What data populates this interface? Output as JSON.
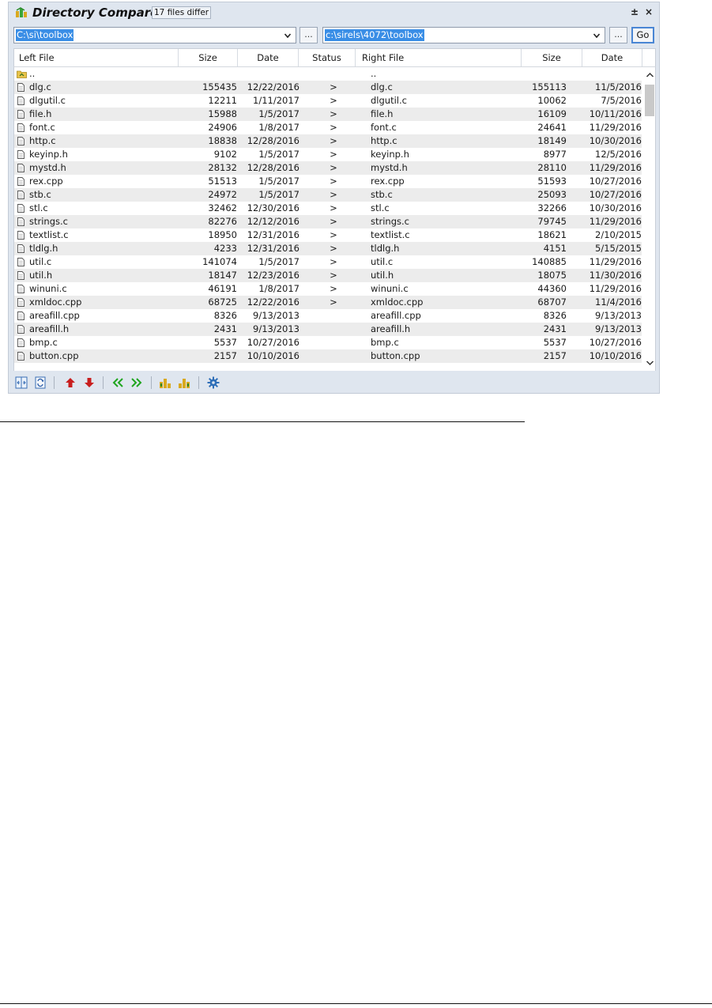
{
  "window": {
    "title": "Directory Compare",
    "diff_badge": "17 files differ",
    "pin_glyph": "±",
    "close_glyph": "×"
  },
  "paths": {
    "left": "C:\\si\\toolbox",
    "right": "c:\\sirels\\4072\\toolbox",
    "browse_label": "...",
    "go_label": "Go"
  },
  "columns": {
    "left_file": "Left File",
    "left_size": "Size",
    "left_date": "Date",
    "status": "Status",
    "right_file": "Right File",
    "right_size": "Size",
    "right_date": "Date"
  },
  "parent_row": {
    "left": "..",
    "right": ".."
  },
  "rows": [
    {
      "lname": "dlg.c",
      "lsize": "155435",
      "ldate": "12/22/2016",
      "status": ">",
      "rname": "dlg.c",
      "rsize": "155113",
      "rdate": "11/5/2016"
    },
    {
      "lname": "dlgutil.c",
      "lsize": "12211",
      "ldate": "1/11/2017",
      "status": ">",
      "rname": "dlgutil.c",
      "rsize": "10062",
      "rdate": "7/5/2016"
    },
    {
      "lname": "file.h",
      "lsize": "15988",
      "ldate": "1/5/2017",
      "status": ">",
      "rname": "file.h",
      "rsize": "16109",
      "rdate": "10/11/2016"
    },
    {
      "lname": "font.c",
      "lsize": "24906",
      "ldate": "1/8/2017",
      "status": ">",
      "rname": "font.c",
      "rsize": "24641",
      "rdate": "11/29/2016"
    },
    {
      "lname": "http.c",
      "lsize": "18838",
      "ldate": "12/28/2016",
      "status": ">",
      "rname": "http.c",
      "rsize": "18149",
      "rdate": "10/30/2016"
    },
    {
      "lname": "keyinp.h",
      "lsize": "9102",
      "ldate": "1/5/2017",
      "status": ">",
      "rname": "keyinp.h",
      "rsize": "8977",
      "rdate": "12/5/2016"
    },
    {
      "lname": "mystd.h",
      "lsize": "28132",
      "ldate": "12/28/2016",
      "status": ">",
      "rname": "mystd.h",
      "rsize": "28110",
      "rdate": "11/29/2016"
    },
    {
      "lname": "rex.cpp",
      "lsize": "51513",
      "ldate": "1/5/2017",
      "status": ">",
      "rname": "rex.cpp",
      "rsize": "51593",
      "rdate": "10/27/2016"
    },
    {
      "lname": "stb.c",
      "lsize": "24972",
      "ldate": "1/5/2017",
      "status": ">",
      "rname": "stb.c",
      "rsize": "25093",
      "rdate": "10/27/2016"
    },
    {
      "lname": "stl.c",
      "lsize": "32462",
      "ldate": "12/30/2016",
      "status": ">",
      "rname": "stl.c",
      "rsize": "32266",
      "rdate": "10/30/2016"
    },
    {
      "lname": "strings.c",
      "lsize": "82276",
      "ldate": "12/12/2016",
      "status": ">",
      "rname": "strings.c",
      "rsize": "79745",
      "rdate": "11/29/2016"
    },
    {
      "lname": "textlist.c",
      "lsize": "18950",
      "ldate": "12/31/2016",
      "status": ">",
      "rname": "textlist.c",
      "rsize": "18621",
      "rdate": "2/10/2015"
    },
    {
      "lname": "tldlg.h",
      "lsize": "4233",
      "ldate": "12/31/2016",
      "status": ">",
      "rname": "tldlg.h",
      "rsize": "4151",
      "rdate": "5/15/2015"
    },
    {
      "lname": "util.c",
      "lsize": "141074",
      "ldate": "1/5/2017",
      "status": ">",
      "rname": "util.c",
      "rsize": "140885",
      "rdate": "11/29/2016"
    },
    {
      "lname": "util.h",
      "lsize": "18147",
      "ldate": "12/23/2016",
      "status": ">",
      "rname": "util.h",
      "rsize": "18075",
      "rdate": "11/30/2016"
    },
    {
      "lname": "winuni.c",
      "lsize": "46191",
      "ldate": "1/8/2017",
      "status": ">",
      "rname": "winuni.c",
      "rsize": "44360",
      "rdate": "11/29/2016"
    },
    {
      "lname": "xmldoc.cpp",
      "lsize": "68725",
      "ldate": "12/22/2016",
      "status": ">",
      "rname": "xmldoc.cpp",
      "rsize": "68707",
      "rdate": "11/4/2016"
    },
    {
      "lname": "areafill.cpp",
      "lsize": "8326",
      "ldate": "9/13/2013",
      "status": "",
      "rname": "areafill.cpp",
      "rsize": "8326",
      "rdate": "9/13/2013"
    },
    {
      "lname": "areafill.h",
      "lsize": "2431",
      "ldate": "9/13/2013",
      "status": "",
      "rname": "areafill.h",
      "rsize": "2431",
      "rdate": "9/13/2013"
    },
    {
      "lname": "bmp.c",
      "lsize": "5537",
      "ldate": "10/27/2016",
      "status": "",
      "rname": "bmp.c",
      "rsize": "5537",
      "rdate": "10/27/2016"
    },
    {
      "lname": "button.cpp",
      "lsize": "2157",
      "ldate": "10/10/2016",
      "status": "",
      "rname": "button.cpp",
      "rsize": "2157",
      "rdate": "10/10/2016"
    }
  ],
  "toolbar_icons": [
    "compare-layout-icon",
    "refresh-icon",
    "previous-difference-icon",
    "next-difference-icon",
    "copy-to-left-icon",
    "copy-to-right-icon",
    "show-left-only-icon",
    "show-right-only-icon",
    "settings-gear-icon"
  ],
  "colors": {
    "panel_bg": "#dfe6ef",
    "selection": "#3a8ee6",
    "alt_row": "#ececec",
    "arrow_red": "#c81e1e",
    "arrow_green": "#1fa51f",
    "focus_border": "#4a86d4"
  }
}
